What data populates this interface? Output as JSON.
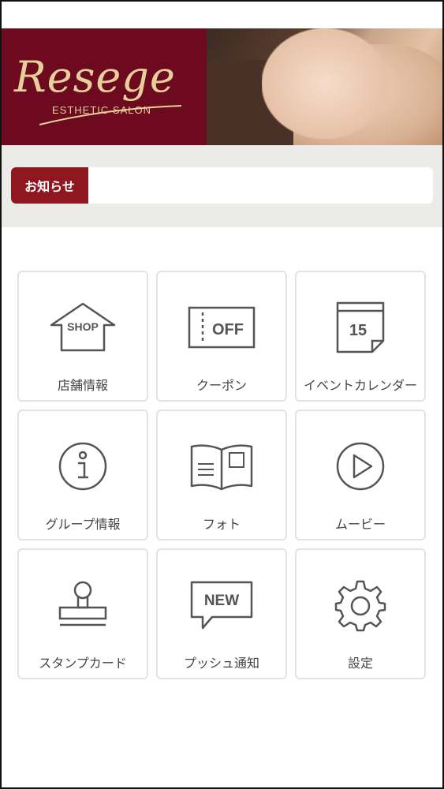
{
  "header": {
    "logo_text": "Resege",
    "logo_subtitle": "ESTHETIC SALON",
    "colors": {
      "brand": "#6e0a20",
      "gold": "#e7cf9b"
    }
  },
  "notice": {
    "label": "お知らせ",
    "text": "",
    "colors": {
      "label_bg": "#8f1820"
    }
  },
  "menu": {
    "items": [
      {
        "label": "店舗情報",
        "icon": "shop-icon",
        "icon_text": "SHOP"
      },
      {
        "label": "クーポン",
        "icon": "coupon-icon",
        "icon_text": "OFF"
      },
      {
        "label": "イベントカレンダー",
        "icon": "calendar-icon",
        "icon_text": "15"
      },
      {
        "label": "グループ情報",
        "icon": "info-icon"
      },
      {
        "label": "フォト",
        "icon": "photo-album-icon"
      },
      {
        "label": "ムービー",
        "icon": "play-icon"
      },
      {
        "label": "スタンプカード",
        "icon": "stamp-icon"
      },
      {
        "label": "プッシュ通知",
        "icon": "push-notification-icon",
        "icon_text": "NEW"
      },
      {
        "label": "設定",
        "icon": "gear-icon"
      }
    ]
  }
}
